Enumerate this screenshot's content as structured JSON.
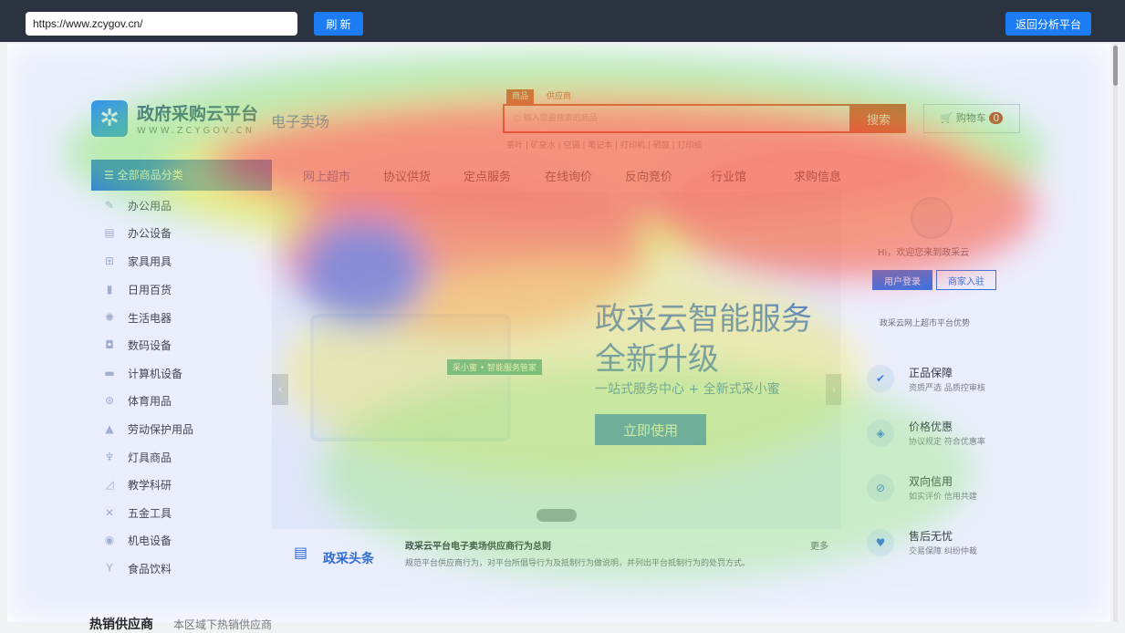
{
  "browser": {
    "url": "https://www.zcygov.cn/",
    "refresh_label": "刷 新",
    "back_label": "返回分析平台"
  },
  "header": {
    "logo_title": "政府采购云平台",
    "logo_sub": "WWW.ZCYGOV.CN",
    "market": "电子卖场",
    "search_tabs": [
      "商品",
      "供应商"
    ],
    "search_placeholder": "输入您要搜索的商品",
    "search_button": "搜索",
    "cart_label": "购物车",
    "cart_count": "0",
    "hot_words": "茶叶 | 矿泉水 | 空调 | 笔记本 | 打印机 | 硒鼓 | 打印纸"
  },
  "nav": {
    "all_categories": "全部商品分类",
    "items": [
      "网上超市",
      "协议供货",
      "定点服务",
      "在线询价",
      "反向竞价",
      "行业馆",
      "求购信息"
    ]
  },
  "categories": [
    "办公用品",
    "办公设备",
    "家具用具",
    "日用百货",
    "生活电器",
    "数码设备",
    "计算机设备",
    "体育用品",
    "劳动保护用品",
    "灯具商品",
    "教学科研",
    "五金工具",
    "机电设备",
    "食品饮料"
  ],
  "banner": {
    "line1": "政采云智能服务",
    "line2": "全新升级",
    "line3": "一站式服务中心 + 全新式采小蜜",
    "cta": "立即使用",
    "badge": "采小蜜 • 智能服务管家"
  },
  "news": {
    "brand": "政采头条",
    "title": "政采云平台电子卖场供应商行为总则",
    "desc": "规范平台供应商行为，对平台所倡导行为及抵制行为做说明，并列出平台抵制行为的处罚方式。",
    "more": "更多"
  },
  "user": {
    "greeting": "Hi，欢迎您来到政采云",
    "login": "用户登录",
    "join": "商家入驻",
    "advantage": "政采云网上超市平台优势"
  },
  "features": [
    {
      "title": "正品保障",
      "desc": "资质严选 品质控审核"
    },
    {
      "title": "价格优惠",
      "desc": "协议规定 符合优惠率"
    },
    {
      "title": "双向信用",
      "desc": "如实评价 信用共建"
    },
    {
      "title": "售后无忧",
      "desc": "交易保障 纠纷仲裁"
    }
  ],
  "bottom": {
    "title": "热销供应商",
    "subtitle": "本区域下热销供应商"
  },
  "colors": {
    "primary": "#1669e6",
    "search_red": "#d81e06"
  }
}
